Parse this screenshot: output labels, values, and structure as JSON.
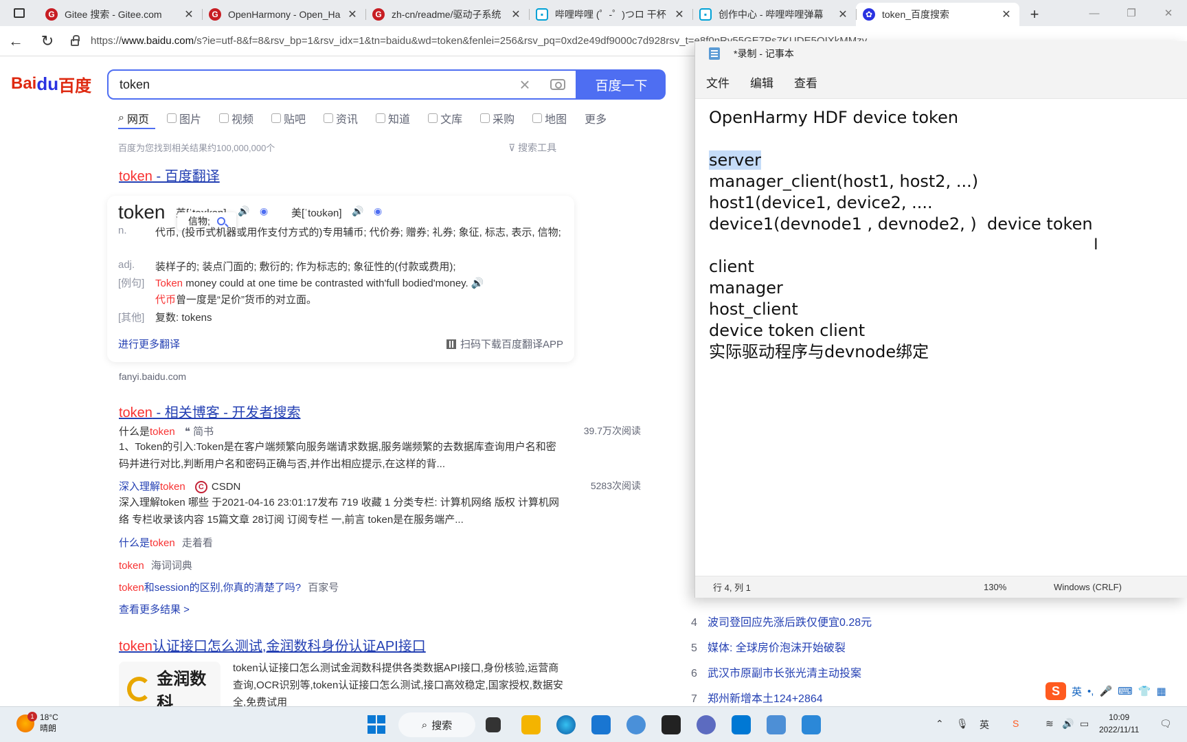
{
  "browser": {
    "tabs": [
      {
        "label": "Gitee 搜索 - Gitee.com",
        "icon": "gitee-icon"
      },
      {
        "label": "OpenHarmony - Open_Ha",
        "icon": "gitee-icon"
      },
      {
        "label": "zh-cn/readme/驱动子系统",
        "icon": "gitee-icon"
      },
      {
        "label": "哔哩哔哩 (゜-゜)つロ 干杯",
        "icon": "bilibili-icon"
      },
      {
        "label": "创作中心 - 哔哩哔哩弹幕",
        "icon": "bilibili-icon"
      },
      {
        "label": "token_百度搜索",
        "icon": "baidu-icon",
        "active": true
      }
    ],
    "url_prefix": "https://",
    "url_host": "www.baidu.com",
    "url_rest": "/s?ie=utf-8&f=8&rsv_bp=1&rsv_idx=1&tn=baidu&wd=token&fenlei=256&rsv_pq=0xd2e49df9000c7d928rsv_t=e8f0nRv55GE7Ps7KUDE5QIXkMMzv"
  },
  "baidu": {
    "logo_text": "Bai",
    "logo_paw": "du",
    "logo_cn": "百度",
    "query": "token",
    "search_button": "百度一下",
    "tabs": [
      "网页",
      "图片",
      "视频",
      "贴吧",
      "资讯",
      "知道",
      "文库",
      "采购",
      "地图",
      "更多"
    ],
    "stats": "百度为您找到相关结果约100,000,000个",
    "search_tools": "搜索工具",
    "result1": {
      "title_em": "token",
      "title_rest": " - 百度翻译",
      "word": "token",
      "uk": "英[ˈtəʊkən]",
      "us": "美[ˈtoʊkən]",
      "popup": "信物;",
      "defs": [
        {
          "pos": "n.",
          "text": "代币, (投币式机器或用作支付方式的)专用辅币; 代价券; 赠券; 礼券; 象征, 标志, 表示, 信物;"
        },
        {
          "pos": "adj.",
          "text": "装样子的; 装点门面的; 敷衍的; 作为标志的; 象征性的(付款或费用);"
        }
      ],
      "example_label": "[例句]",
      "example_em": "Token",
      "example_en": " money could at one time be contrasted with'full bodied'money.",
      "example_cn_em": "代币",
      "example_cn": "曾一度是“足价”货币的对立面。",
      "other_label": "[其他]",
      "other_text": "复数: tokens",
      "more_link": "进行更多翻译",
      "download_app": "扫码下载百度翻译APP",
      "source": "fanyi.baidu.com"
    },
    "result2": {
      "title_em": "token",
      "title_rest": " - 相关博客 - 开发者搜索",
      "items": [
        {
          "pre": "什么是",
          "em": "token",
          "src": "简书",
          "reads": "39.7万次阅读"
        },
        {
          "pre": "深入理解",
          "em": "token",
          "src": "CSDN",
          "reads": "5283次阅读"
        }
      ],
      "snippet1": "1、Token的引入:Token是在客户端频繁向服务端请求数据,服务端频繁的去数据库查询用户名和密码并进行对比,判断用户名和密码正确与否,并作出相应提示,在这样的背...",
      "snippet2": "深入理解token 哪些 于2021-04-16 23:01:17发布 719 收藏 1 分类专栏: 计算机网络 版权 计算机网络 专栏收录该内容 15篇文章 28订阅 订阅专栏 一,前言 token是在服务端产...",
      "links": [
        {
          "pre": "什么是",
          "em": "token",
          "post": "",
          "tag": "走着看"
        },
        {
          "pre": "",
          "em": "token",
          "post": "",
          "tag": "海词词典"
        },
        {
          "pre": "",
          "em": "token",
          "post": "和session的区别,你真的清楚了吗?",
          "tag": "百家号"
        }
      ],
      "see_more": "查看更多结果 >"
    },
    "result3": {
      "title_em": "token",
      "title_rest": "认证接口怎么测试,金润数科身份认证API接口",
      "logo_text": "金润数科",
      "snippet": "token认证接口怎么测试金润数科提供各类数据API接口,身份核验,运营商查询,OCR识别等,token认证接口怎么测试,接口高效稳定,国家授权,数据安全,免费试用"
    },
    "hotlist": [
      {
        "n": "4",
        "text": "波司登回应先涨后跌仅便宜0.28元"
      },
      {
        "n": "5",
        "text": "媒体: 全球房价泡沫开始破裂"
      },
      {
        "n": "6",
        "text": "武汉市原副市长张光清主动投案"
      },
      {
        "n": "7",
        "text": "郑州新增本土124+2864"
      }
    ]
  },
  "notepad": {
    "title": "*录制 - 记事本",
    "menu": [
      "文件",
      "编辑",
      "查看"
    ],
    "lines": [
      "OpenHarmy HDF device token",
      "",
      "server",
      "manager_client(host1, host2, ...)",
      "host1(device1, device2, ....",
      "device1(devnode1 , devnode2, )  device token",
      "",
      "client",
      "manager",
      "host_client",
      "device token client",
      "实际驱动程序与devnode绑定"
    ],
    "status_pos": "行 4, 列 1",
    "status_zoom": "130%",
    "status_eol": "Windows (CRLF)"
  },
  "taskbar": {
    "temp": "18°C",
    "weather": "晴朗",
    "weather_badge": "1",
    "search": "搜索",
    "ime_lang": "英",
    "time": "10:09",
    "date": "2022/11/11"
  }
}
